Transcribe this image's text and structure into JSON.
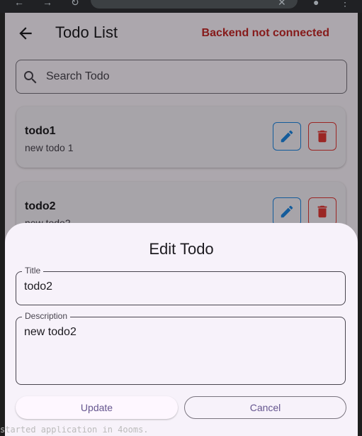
{
  "appbar": {
    "title": "Todo List",
    "status": "Backend not connected",
    "status_color": "#c62828",
    "back_icon": "arrow-back-icon"
  },
  "search": {
    "placeholder": "Search Todo",
    "icon": "search-icon"
  },
  "todos": [
    {
      "title": "todo1",
      "description": "new todo 1"
    },
    {
      "title": "todo2",
      "description": "new todo2"
    }
  ],
  "dialog": {
    "title": "Edit Todo",
    "title_label": "Title",
    "title_value": "todo2",
    "description_label": "Description",
    "description_value": "new todo2",
    "update_label": "Update",
    "cancel_label": "Cancel"
  },
  "background": {
    "terminal_bottom_text": "started application in 4ooms."
  },
  "colors": {
    "primary": "#65558f",
    "edit": "#1e88e5",
    "delete": "#e53935",
    "surface": "#fef7ff",
    "sheet": "#f7f2fa"
  }
}
